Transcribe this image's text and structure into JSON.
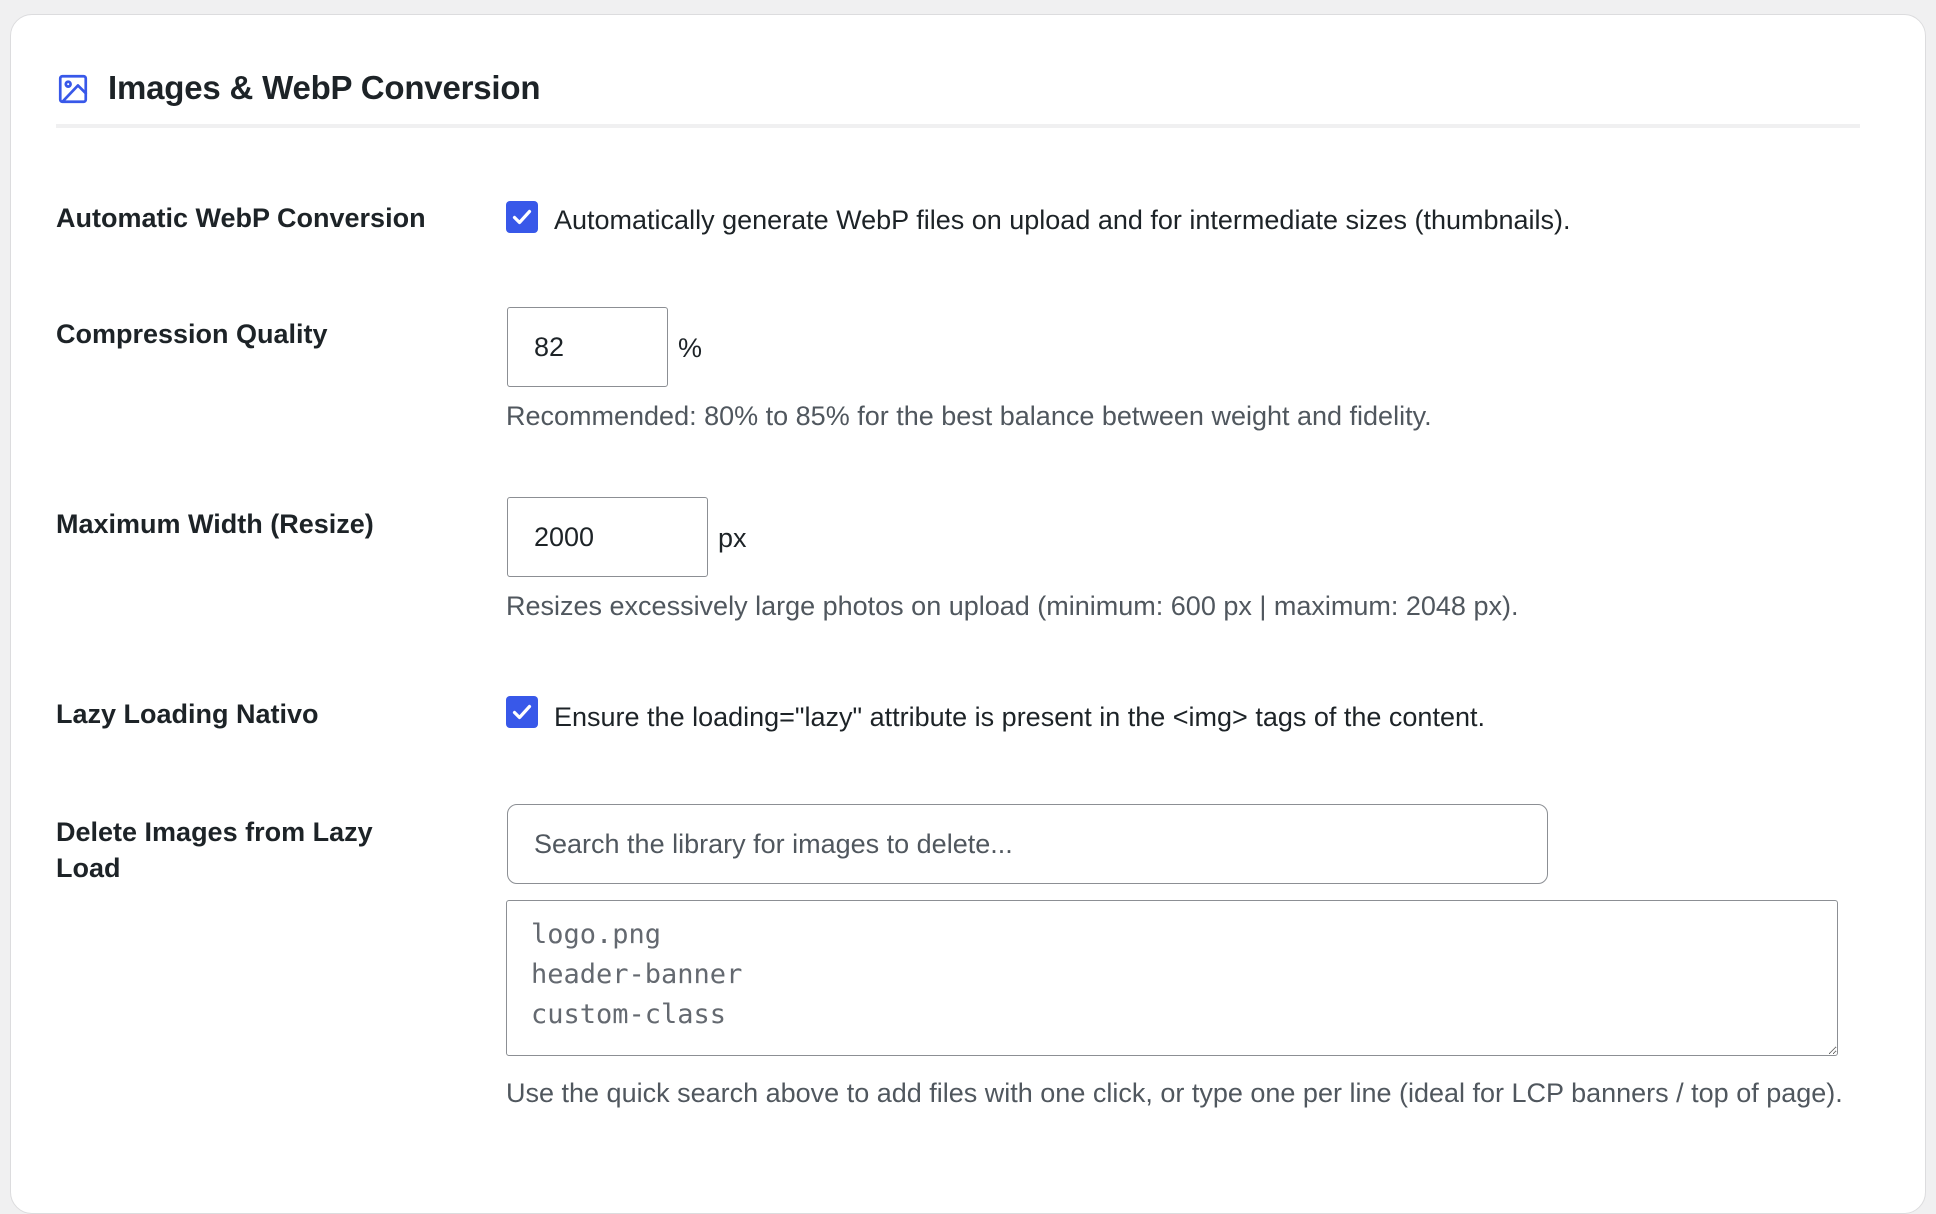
{
  "section": {
    "title": "Images & WebP Conversion",
    "icon": "image-icon",
    "accent_color": "#3858e9"
  },
  "rows": {
    "webp": {
      "label": "Automatic WebP Conversion",
      "checked": true,
      "checkbox_text": "Automatically generate WebP files on upload and for intermediate sizes (thumbnails)."
    },
    "quality": {
      "label": "Compression Quality",
      "value": "82",
      "unit": "%",
      "description": "Recommended: 80% to 85% for the best balance between weight and fidelity."
    },
    "max_width": {
      "label": "Maximum Width (Resize)",
      "value": "2000",
      "unit": "px",
      "description": "Resizes excessively large photos on upload (minimum: 600 px | maximum: 2048 px)."
    },
    "lazy": {
      "label": "Lazy Loading Nativo",
      "checked": true,
      "checkbox_text": "Ensure the loading=\"lazy\" attribute is present in the <img> tags of the content."
    },
    "exclude": {
      "label": "Delete Images from Lazy Load",
      "search_placeholder": "Search the library for images to delete...",
      "textarea_placeholder": "logo.png\nheader-banner\ncustom-class",
      "description": "Use the quick search above to add files with one click, or type one per line (ideal for LCP banners / top of page)."
    }
  }
}
